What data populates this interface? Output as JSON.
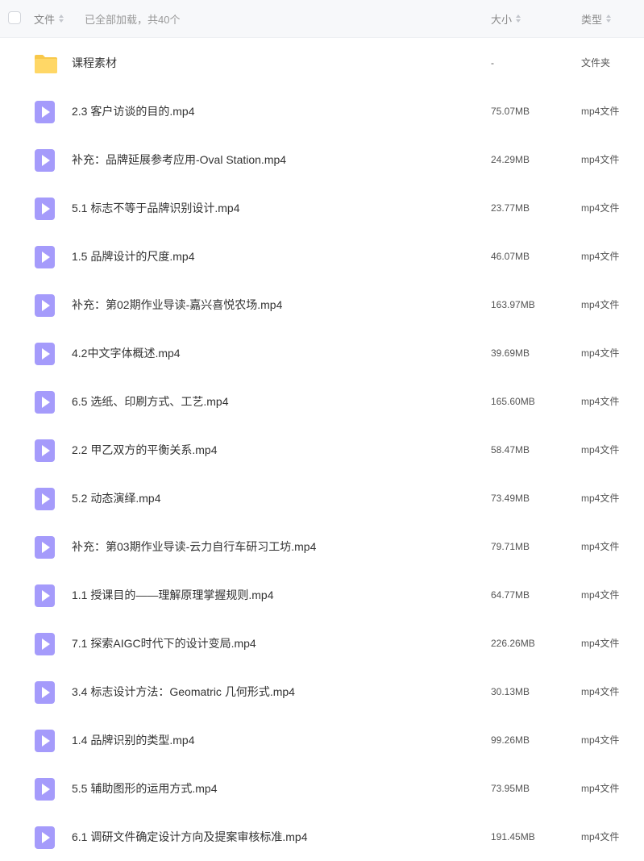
{
  "header": {
    "name_label": "文件",
    "status": "已全部加载，共40个",
    "size_label": "大小",
    "type_label": "类型"
  },
  "colors": {
    "video_icon": "#a59bfb",
    "folder_icon": "#ffd766",
    "header_bg": "#f7f8fa"
  },
  "files": [
    {
      "icon": "folder-icon",
      "name": "课程素材",
      "size": "-",
      "type": "文件夹"
    },
    {
      "icon": "video-file-icon",
      "name": "2.3 客户访谈的目的.mp4",
      "size": "75.07MB",
      "type": "mp4文件"
    },
    {
      "icon": "video-file-icon",
      "name": "补充：品牌延展参考应用-Oval Station.mp4",
      "size": "24.29MB",
      "type": "mp4文件"
    },
    {
      "icon": "video-file-icon",
      "name": "5.1 标志不等于品牌识别设计.mp4",
      "size": "23.77MB",
      "type": "mp4文件"
    },
    {
      "icon": "video-file-icon",
      "name": "1.5 品牌设计的尺度.mp4",
      "size": "46.07MB",
      "type": "mp4文件"
    },
    {
      "icon": "video-file-icon",
      "name": "补充：第02期作业导读-嘉兴喜悦农场.mp4",
      "size": "163.97MB",
      "type": "mp4文件"
    },
    {
      "icon": "video-file-icon",
      "name": "4.2中文字体概述.mp4",
      "size": "39.69MB",
      "type": "mp4文件"
    },
    {
      "icon": "video-file-icon",
      "name": "6.5 选纸、印刷方式、工艺.mp4",
      "size": "165.60MB",
      "type": "mp4文件"
    },
    {
      "icon": "video-file-icon",
      "name": "2.2 甲乙双方的平衡关系.mp4",
      "size": "58.47MB",
      "type": "mp4文件"
    },
    {
      "icon": "video-file-icon",
      "name": "5.2 动态演绎.mp4",
      "size": "73.49MB",
      "type": "mp4文件"
    },
    {
      "icon": "video-file-icon",
      "name": "补充：第03期作业导读-云力自行车研习工坊.mp4",
      "size": "79.71MB",
      "type": "mp4文件"
    },
    {
      "icon": "video-file-icon",
      "name": "1.1 授课目的——理解原理掌握规则.mp4",
      "size": "64.77MB",
      "type": "mp4文件"
    },
    {
      "icon": "video-file-icon",
      "name": "7.1 探索AIGC时代下的设计变局.mp4",
      "size": "226.26MB",
      "type": "mp4文件"
    },
    {
      "icon": "video-file-icon",
      "name": "3.4 标志设计方法：Geomatric 几何形式.mp4",
      "size": "30.13MB",
      "type": "mp4文件"
    },
    {
      "icon": "video-file-icon",
      "name": "1.4 品牌识别的类型.mp4",
      "size": "99.26MB",
      "type": "mp4文件"
    },
    {
      "icon": "video-file-icon",
      "name": "5.5 辅助图形的运用方式.mp4",
      "size": "73.95MB",
      "type": "mp4文件"
    },
    {
      "icon": "video-file-icon",
      "name": "6.1 调研文件确定设计方向及提案审核标准.mp4",
      "size": "191.45MB",
      "type": "mp4文件"
    }
  ]
}
